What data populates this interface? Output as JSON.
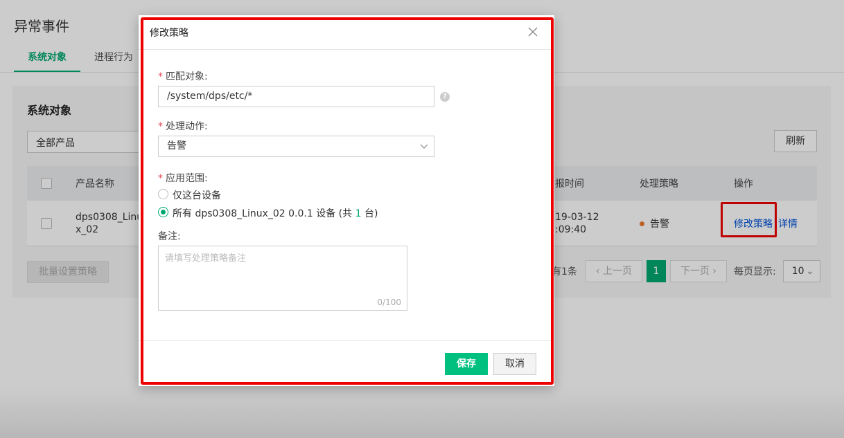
{
  "page": {
    "title": "异常事件",
    "tabs": [
      {
        "label": "系统对象",
        "active": true
      },
      {
        "label": "进程行为",
        "active": false
      }
    ]
  },
  "card": {
    "title": "系统对象",
    "product_select": "全部产品",
    "refresh_label": "刷新",
    "table": {
      "headers": {
        "product_name": "产品名称",
        "report_time": "报时间",
        "policy": "处理策略",
        "ops": "操作"
      },
      "rows": [
        {
          "product_name_line1": "dps0308_Linu",
          "product_name_line2": "x_02",
          "time_line1": "19-03-12",
          "time_line2": ":09:40",
          "policy": "告警",
          "action_modify": "修改策略",
          "action_detail": "详情"
        }
      ]
    },
    "batch_label": "批量设置策略",
    "pager": {
      "total": "有1条",
      "prev": "上一页",
      "current": "1",
      "next": "下一页",
      "page_size_label": "每页显示:",
      "page_size": "10"
    }
  },
  "modal": {
    "title": "修改策略",
    "match_label": "匹配对象:",
    "match_value": "/system/dps/etc/*",
    "action_label": "处理动作:",
    "action_value": "告警",
    "scope_label": "应用范围:",
    "scope_option1": "仅这台设备",
    "scope_option2_prefix": "所有 dps0308_Linux_02 0.0.1 设备 (共 ",
    "scope_option2_count": "1",
    "scope_option2_suffix": " 台)",
    "note_label": "备注:",
    "note_placeholder": "请填写处理策略备注",
    "note_counter": "0/100",
    "save_label": "保存",
    "cancel_label": "取消"
  },
  "colors": {
    "accent": "#00a870",
    "link": "#0052d9",
    "required": "#e34d59",
    "warning_dot": "#ed7b2f",
    "annotation": "#ee0000"
  }
}
